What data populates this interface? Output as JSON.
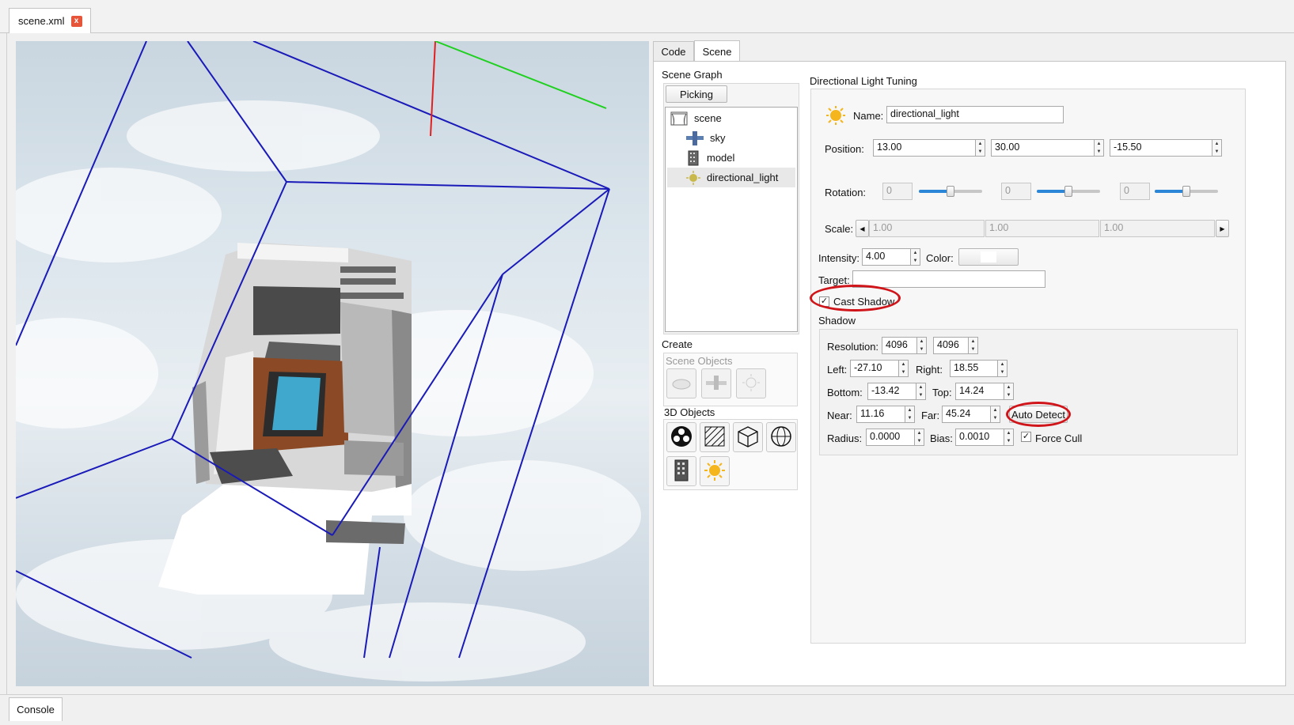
{
  "file_tab": {
    "label": "scene.xml",
    "close_symbol": "x"
  },
  "right_tabs": {
    "code": "Code",
    "scene": "Scene"
  },
  "scene_graph": {
    "title": "Scene Graph",
    "picking_button": "Picking",
    "items": [
      {
        "label": "scene",
        "icon": "scene-icon"
      },
      {
        "label": "sky",
        "icon": "sky-icon"
      },
      {
        "label": "model",
        "icon": "building-icon"
      },
      {
        "label": "directional_light",
        "icon": "sun-icon"
      }
    ],
    "selected": "directional_light"
  },
  "create": {
    "title": "Create",
    "scene_objects_title": "Scene Objects",
    "objects_3d_title": "3D Objects"
  },
  "tuning": {
    "title": "Directional Light Tuning",
    "name_label": "Name:",
    "name_value": "directional_light",
    "position_label": "Position:",
    "position": [
      "13.00",
      "30.00",
      "-15.50"
    ],
    "rotation_label": "Rotation:",
    "rotation": [
      "0",
      "0",
      "0"
    ],
    "rotation_slider_fraction": [
      0.5,
      0.5,
      0.5
    ],
    "scale_label": "Scale:",
    "scale": [
      "1.00",
      "1.00",
      "1.00"
    ],
    "intensity_label": "Intensity:",
    "intensity": "4.00",
    "color_label": "Color:",
    "color_value": "#ffffff",
    "target_label": "Target:",
    "target_value": "",
    "cast_shadow_label": "Cast Shadow",
    "cast_shadow_checked": true,
    "shadow_title": "Shadow",
    "resolution_label": "Resolution:",
    "resolution": [
      "4096",
      "4096"
    ],
    "left_label": "Left:",
    "left": "-27.10",
    "right_label": "Right:",
    "right": "18.55",
    "bottom_label": "Bottom:",
    "bottom": "-13.42",
    "top_label": "Top:",
    "top": "14.24",
    "near_label": "Near:",
    "near": "11.16",
    "far_label": "Far:",
    "far": "45.24",
    "auto_detect_button": "Auto Detect",
    "radius_label": "Radius:",
    "radius": "0.0000",
    "bias_label": "Bias:",
    "bias": "0.0010",
    "force_cull_label": "Force Cull",
    "force_cull_checked": true
  },
  "console_tab": "Console",
  "colors": {
    "frustum": "#1a1ab8",
    "axis_x": "#e02020",
    "axis_y": "#20d020",
    "annotation": "#d0151a",
    "slider": "#2b86d8"
  }
}
